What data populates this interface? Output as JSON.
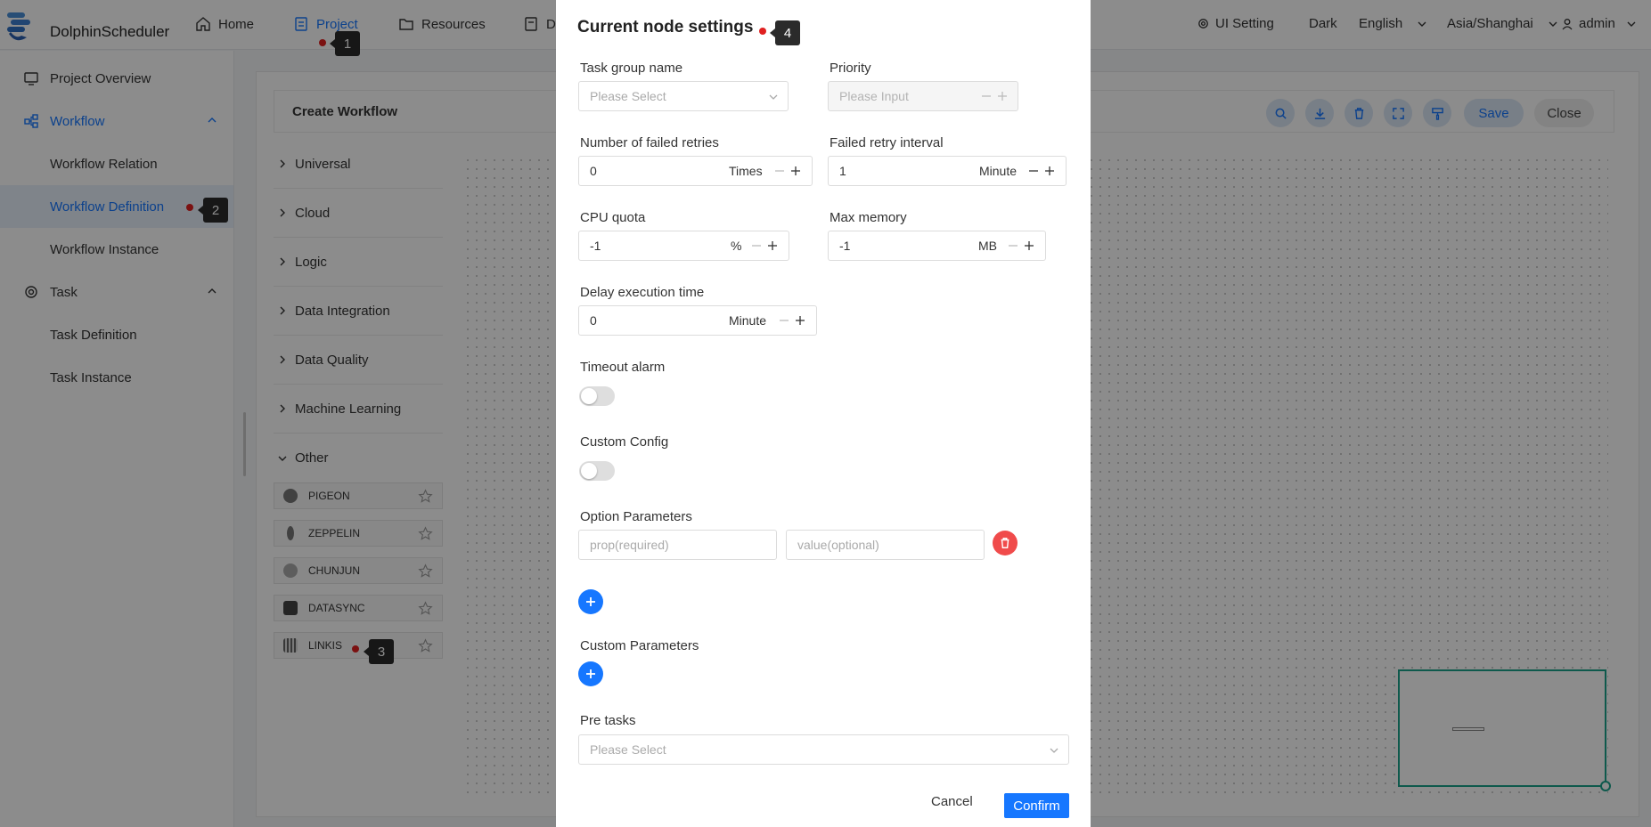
{
  "header": {
    "logo_text": "DolphinScheduler",
    "nav": [
      {
        "label": "Home",
        "icon": "home-icon"
      },
      {
        "label": "Project",
        "icon": "project-icon",
        "active": true
      },
      {
        "label": "Resources",
        "icon": "folder-icon"
      },
      {
        "label": "D",
        "icon": "datasource-icon"
      }
    ],
    "ui_setting": "UI Setting",
    "theme": "Dark",
    "language": "English",
    "timezone": "Asia/Shanghai",
    "user": "admin"
  },
  "sidebar": {
    "items": [
      {
        "label": "Project Overview"
      },
      {
        "label": "Workflow"
      },
      {
        "label": "Workflow Relation"
      },
      {
        "label": "Workflow Definition"
      },
      {
        "label": "Workflow Instance"
      },
      {
        "label": "Task"
      },
      {
        "label": "Task Definition"
      },
      {
        "label": "Task Instance"
      }
    ]
  },
  "workflow": {
    "title": "Create Workflow",
    "save_label": "Save",
    "close_label": "Close",
    "categories": [
      "Universal",
      "Cloud",
      "Logic",
      "Data Integration",
      "Data Quality",
      "Machine Learning",
      "Other"
    ],
    "tasks": [
      "PIGEON",
      "ZEPPELIN",
      "CHUNJUN",
      "DATASYNC",
      "LINKIS"
    ]
  },
  "modal": {
    "title": "Current node settings",
    "task_group_label": "Task group name",
    "task_group_placeholder": "Please Select",
    "priority_label": "Priority",
    "priority_placeholder": "Please Input",
    "retries_label": "Number of failed retries",
    "retries_value": "0",
    "retries_unit": "Times",
    "retry_interval_label": "Failed retry interval",
    "retry_interval_value": "1",
    "retry_interval_unit": "Minute",
    "cpu_label": "CPU quota",
    "cpu_value": "-1",
    "cpu_unit": "%",
    "memory_label": "Max memory",
    "memory_value": "-1",
    "memory_unit": "MB",
    "delay_label": "Delay execution time",
    "delay_value": "0",
    "delay_unit": "Minute",
    "timeout_label": "Timeout alarm",
    "custom_config_label": "Custom Config",
    "option_params_label": "Option Parameters",
    "prop_placeholder": "prop(required)",
    "value_placeholder": "value(optional)",
    "custom_params_label": "Custom Parameters",
    "pre_tasks_label": "Pre tasks",
    "pre_tasks_placeholder": "Please Select",
    "cancel_label": "Cancel",
    "confirm_label": "Confirm"
  },
  "markers": [
    "1",
    "2",
    "3",
    "4"
  ],
  "colors": {
    "accent": "#1677ff",
    "danger": "#f04b4b",
    "marker": "#e02020",
    "minimap": "#1aa38a"
  }
}
